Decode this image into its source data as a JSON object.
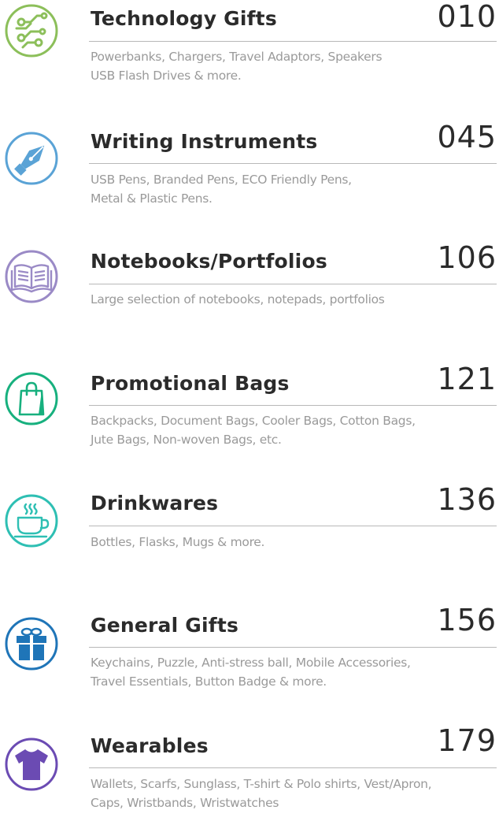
{
  "categories": [
    {
      "icon": "circuit-icon",
      "color": "#8cbf5a",
      "title": "Technology Gifts",
      "page": "010",
      "desc_lines": [
        "Powerbanks, Chargers, Travel Adaptors, Speakers",
        "USB Flash Drives & more."
      ]
    },
    {
      "icon": "fountain-pen-icon",
      "color": "#5aa3d6",
      "title": "Writing Instruments",
      "page": "045",
      "desc_lines": [
        "USB Pens, Branded Pens, ECO Friendly Pens,",
        "Metal & Plastic Pens."
      ]
    },
    {
      "icon": "open-book-icon",
      "color": "#9a8ac6",
      "title": "Notebooks/Portfolios",
      "page": "106",
      "desc_lines": [
        "Large selection of notebooks, notepads, portfolios"
      ]
    },
    {
      "icon": "shopping-bag-icon",
      "color": "#17b07e",
      "title": "Promotional Bags",
      "page": "121",
      "desc_lines": [
        "Backpacks, Document Bags, Cooler Bags, Cotton Bags,",
        "Jute Bags, Non-woven Bags, etc."
      ]
    },
    {
      "icon": "coffee-cup-icon",
      "color": "#2ebfb3",
      "title": "Drinkwares",
      "page": "136",
      "desc_lines": [
        "Bottles, Flasks, Mugs & more."
      ]
    },
    {
      "icon": "gift-box-icon",
      "color": "#1f75b8",
      "title": "General Gifts",
      "page": "156",
      "desc_lines": [
        "Keychains, Puzzle, Anti-stress ball, Mobile Accessories,",
        "Travel Essentials, Button Badge & more."
      ]
    },
    {
      "icon": "t-shirt-icon",
      "color": "#6b4bb3",
      "title": "Wearables",
      "page": "179",
      "desc_lines": [
        "Wallets, Scarfs, Sunglass, T-shirt & Polo shirts, Vest/Apron,",
        "Caps, Wristbands, Wristwatches"
      ]
    }
  ]
}
